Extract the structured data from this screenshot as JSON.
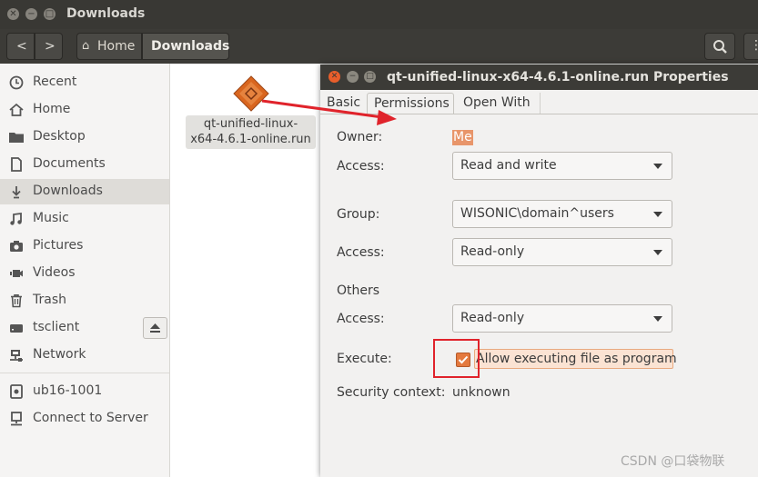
{
  "window": {
    "title": "Downloads"
  },
  "toolbar": {
    "home_label": "Home",
    "current_label": "Downloads"
  },
  "sidebar": {
    "items": [
      {
        "label": "Recent",
        "icon": "clock-icon"
      },
      {
        "label": "Home",
        "icon": "home-icon"
      },
      {
        "label": "Desktop",
        "icon": "folder-icon"
      },
      {
        "label": "Documents",
        "icon": "document-icon"
      },
      {
        "label": "Downloads",
        "icon": "download-icon",
        "active": true
      },
      {
        "label": "Music",
        "icon": "music-icon"
      },
      {
        "label": "Pictures",
        "icon": "camera-icon"
      },
      {
        "label": "Videos",
        "icon": "video-icon"
      },
      {
        "label": "Trash",
        "icon": "trash-icon"
      },
      {
        "label": "tsclient",
        "icon": "drive-icon"
      },
      {
        "label": "Network",
        "icon": "network-icon"
      },
      {
        "label": "ub16-1001",
        "icon": "disk-icon"
      },
      {
        "label": "Connect to Server",
        "icon": "server-icon"
      }
    ]
  },
  "file": {
    "name_line1": "qt-unified-linux-",
    "name_line2": "x64-4.6.1-online.run"
  },
  "dialog": {
    "title": "qt-unified-linux-x64-4.6.1-online.run Properties",
    "tabs": [
      "Basic",
      "Permissions",
      "Open With"
    ],
    "active_tab": "Permissions",
    "owner_label": "Owner:",
    "owner_value": "Me",
    "owner_access_label": "Access:",
    "owner_access": "Read and write",
    "group_label": "Group:",
    "group_value": "WISONIC\\domain^users",
    "group_access_label": "Access:",
    "group_access": "Read-only",
    "others_label": "Others",
    "others_access_label": "Access:",
    "others_access": "Read-only",
    "execute_label": "Execute:",
    "execute_checkbox_label": "Allow executing file as program",
    "execute_checked": true,
    "security_label": "Security context:",
    "security_value": "unknown"
  },
  "watermark": "CSDN @口袋物联",
  "colors": {
    "accent": "#e4793e",
    "annotation": "#e0232b",
    "titlebar": "#3c3b37"
  }
}
